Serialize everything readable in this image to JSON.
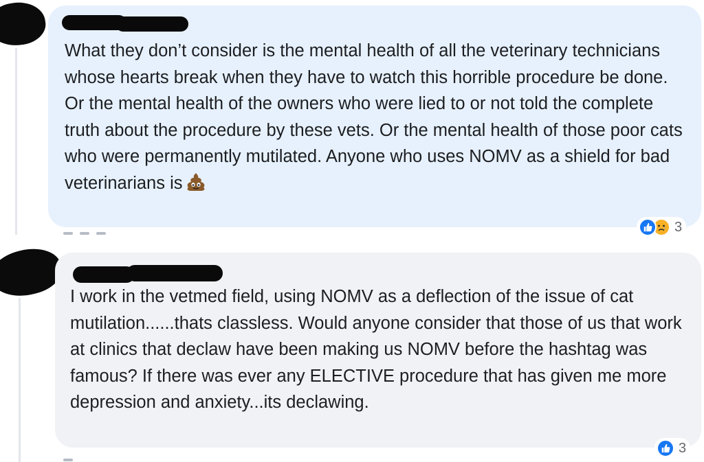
{
  "comments": [
    {
      "text": "What they don’t consider is the mental health of all the veterinary technicians whose hearts break when they have to watch this horrible procedure be done. Or the mental health of the owners who were lied to or not told the complete truth about the procedure by these vets. Or the mental health of those poor cats who were permanently mutilated. Anyone who uses NOMV as a shield for bad veterinarians is",
      "trailing_emoji": "poo-emoji",
      "reactions": [
        "like-icon",
        "sad-icon"
      ],
      "reaction_count": "3"
    },
    {
      "text": "I work in the vetmed field, using NOMV as a deflection of the issue of cat mutilation......thats classless. Would anyone consider that those of us that work at clinics that declaw have been making us NOMV before the hashtag was famous? If there was ever any ELECTIVE procedure that has given me more depression and anxiety...its declawing.",
      "reactions": [
        "like-icon"
      ],
      "reaction_count": "3"
    }
  ],
  "colors": {
    "bubble_first": "#e7f1fd",
    "bubble_second": "#f0f2f5",
    "like": "#1877f2",
    "sad": "#f7b125",
    "text": "#1c1e21"
  }
}
